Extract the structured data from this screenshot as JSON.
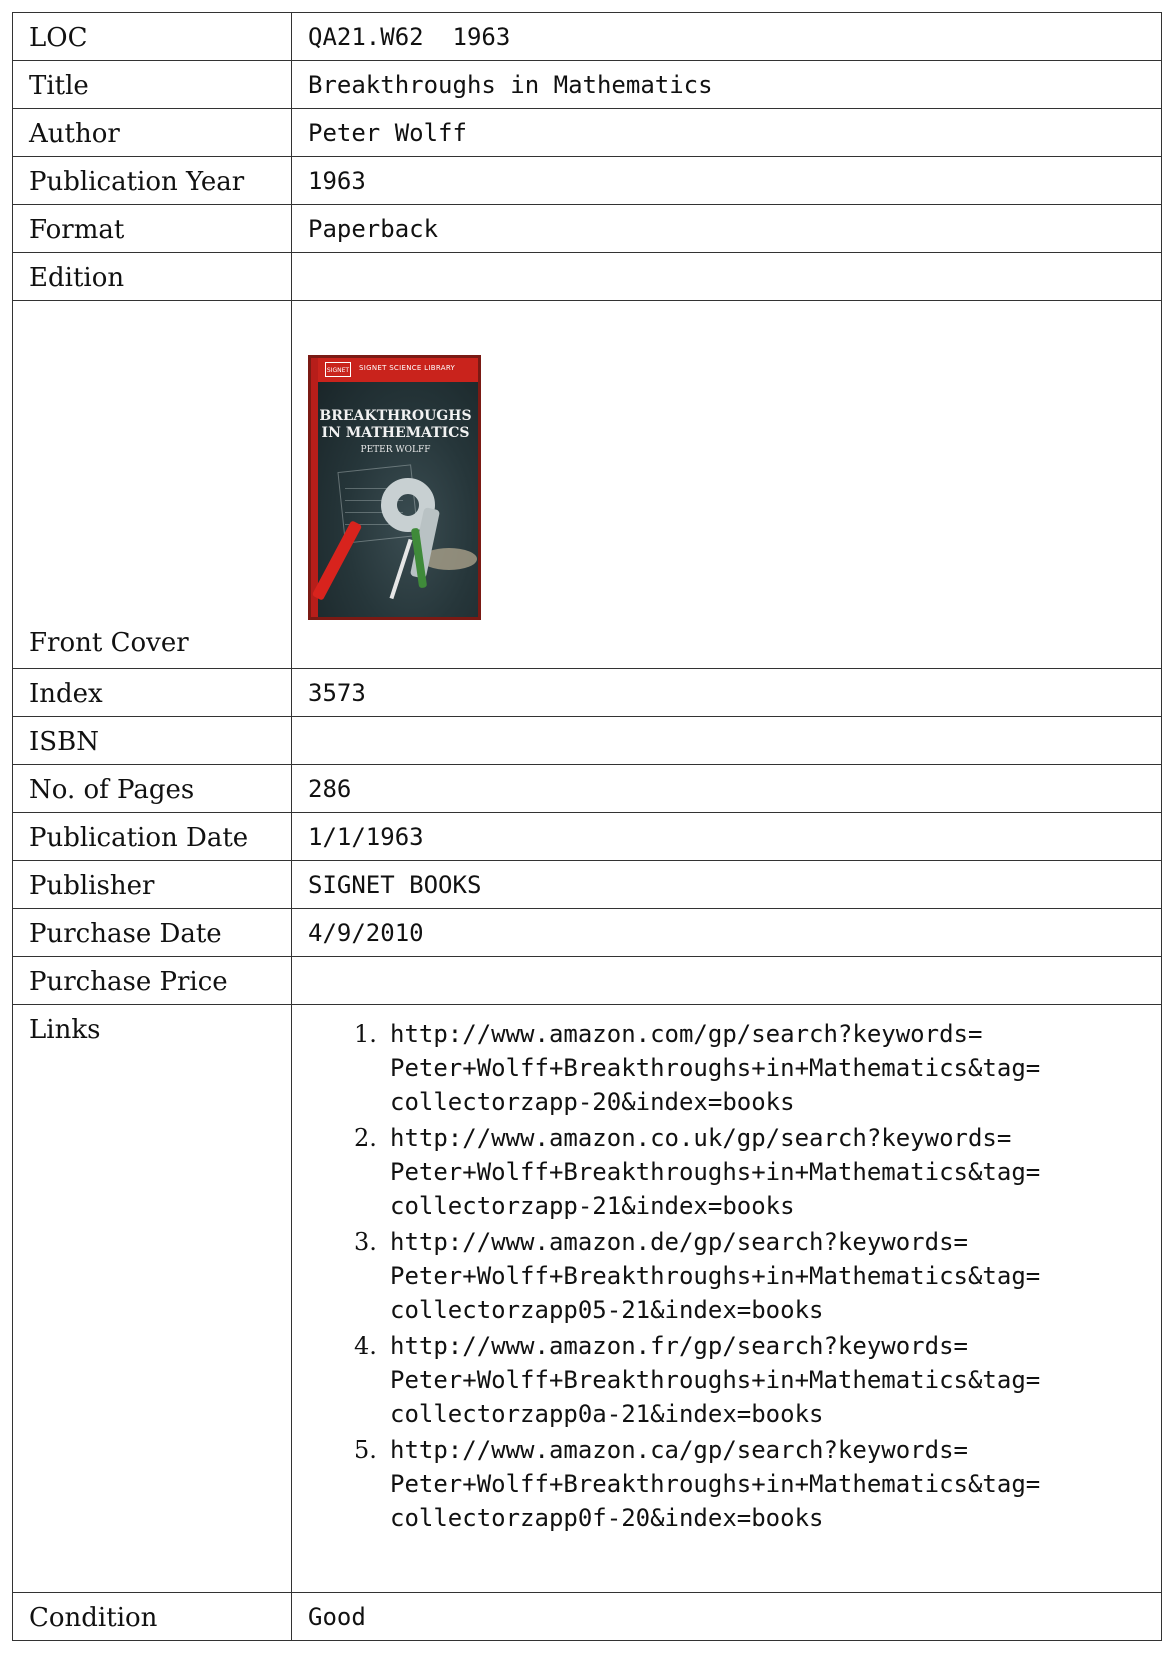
{
  "rows": {
    "loc": {
      "label": "LOC",
      "value": "QA21.W62  1963"
    },
    "title": {
      "label": "Title",
      "value": "Breakthroughs in Mathematics"
    },
    "author": {
      "label": "Author",
      "value": "Peter Wolff"
    },
    "publication_year": {
      "label": "Publication Year",
      "value": "1963"
    },
    "format": {
      "label": "Format",
      "value": "Paperback"
    },
    "edition": {
      "label": "Edition",
      "value": ""
    },
    "front_cover": {
      "label": "Front Cover"
    },
    "index": {
      "label": "Index",
      "value": "3573"
    },
    "isbn": {
      "label": "ISBN",
      "value": ""
    },
    "pages": {
      "label": "No. of Pages",
      "value": "286"
    },
    "publication_date": {
      "label": "Publication Date",
      "value": "1/1/1963"
    },
    "publisher": {
      "label": "Publisher",
      "value": "SIGNET BOOKS"
    },
    "purchase_date": {
      "label": "Purchase Date",
      "value": "4/9/2010"
    },
    "purchase_price": {
      "label": "Purchase Price",
      "value": ""
    },
    "links": {
      "label": "Links"
    },
    "condition": {
      "label": "Condition",
      "value": "Good"
    }
  },
  "cover": {
    "logo": "SIGNET",
    "series": "SIGNET SCIENCE LIBRARY",
    "title_line1": "BREAKTHROUGHS",
    "title_line2": "IN MATHEMATICS",
    "author": "PETER WOLFF"
  },
  "links": [
    {
      "number": "1.",
      "lines": [
        "http://www.amazon.com/gp/search?keywords=",
        "Peter+Wolff+Breakthroughs+in+Mathematics&tag=",
        "collectorzapp-20&index=books"
      ]
    },
    {
      "number": "2.",
      "lines": [
        "http://www.amazon.co.uk/gp/search?keywords=",
        "Peter+Wolff+Breakthroughs+in+Mathematics&tag=",
        "collectorzapp-21&index=books"
      ]
    },
    {
      "number": "3.",
      "lines": [
        "http://www.amazon.de/gp/search?keywords=",
        "Peter+Wolff+Breakthroughs+in+Mathematics&tag=",
        "collectorzapp05-21&index=books"
      ]
    },
    {
      "number": "4.",
      "lines": [
        "http://www.amazon.fr/gp/search?keywords=",
        "Peter+Wolff+Breakthroughs+in+Mathematics&tag=",
        "collectorzapp0a-21&index=books"
      ]
    },
    {
      "number": "5.",
      "lines": [
        "http://www.amazon.ca/gp/search?keywords=",
        "Peter+Wolff+Breakthroughs+in+Mathematics&tag=",
        "collectorzapp0f-20&index=books"
      ]
    }
  ]
}
